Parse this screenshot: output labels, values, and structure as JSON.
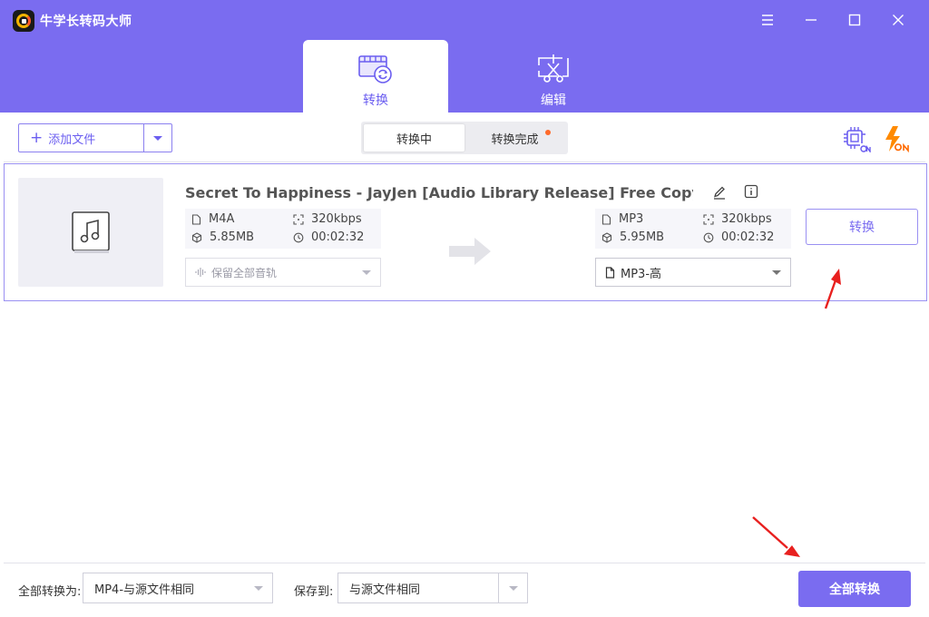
{
  "app": {
    "title": "牛学长转码大师"
  },
  "main_tabs": [
    {
      "label": "转换",
      "active": true
    },
    {
      "label": "编辑",
      "active": false
    }
  ],
  "toolbar": {
    "add_file_label": "添加文件",
    "segments": [
      {
        "label": "转换中",
        "active": true
      },
      {
        "label": "转换完成",
        "active": false,
        "has_dot": true
      }
    ]
  },
  "file": {
    "name": "Secret To Happiness - JayJen [Audio Library Release] Free Copyrig...",
    "source": {
      "format": "M4A",
      "bitrate": "320kbps",
      "size": "5.85MB",
      "duration": "00:02:32"
    },
    "target": {
      "format": "MP3",
      "bitrate": "320kbps",
      "size": "5.95MB",
      "duration": "00:02:32"
    },
    "audio_track": "保留全部音轨",
    "output_format": "MP3-高",
    "convert_label": "转换"
  },
  "footer": {
    "convert_all_to_label": "全部转换为:",
    "convert_all_to_value": "MP4-与源文件相同",
    "save_to_label": "保存到:",
    "save_to_value": "与源文件相同",
    "convert_all_button": "全部转换"
  },
  "colors": {
    "accent": "#7a6cf0",
    "accent_text": "#6b5ef0",
    "notification_dot": "#ff6a2a",
    "annotation_arrow": "#e8201f"
  }
}
